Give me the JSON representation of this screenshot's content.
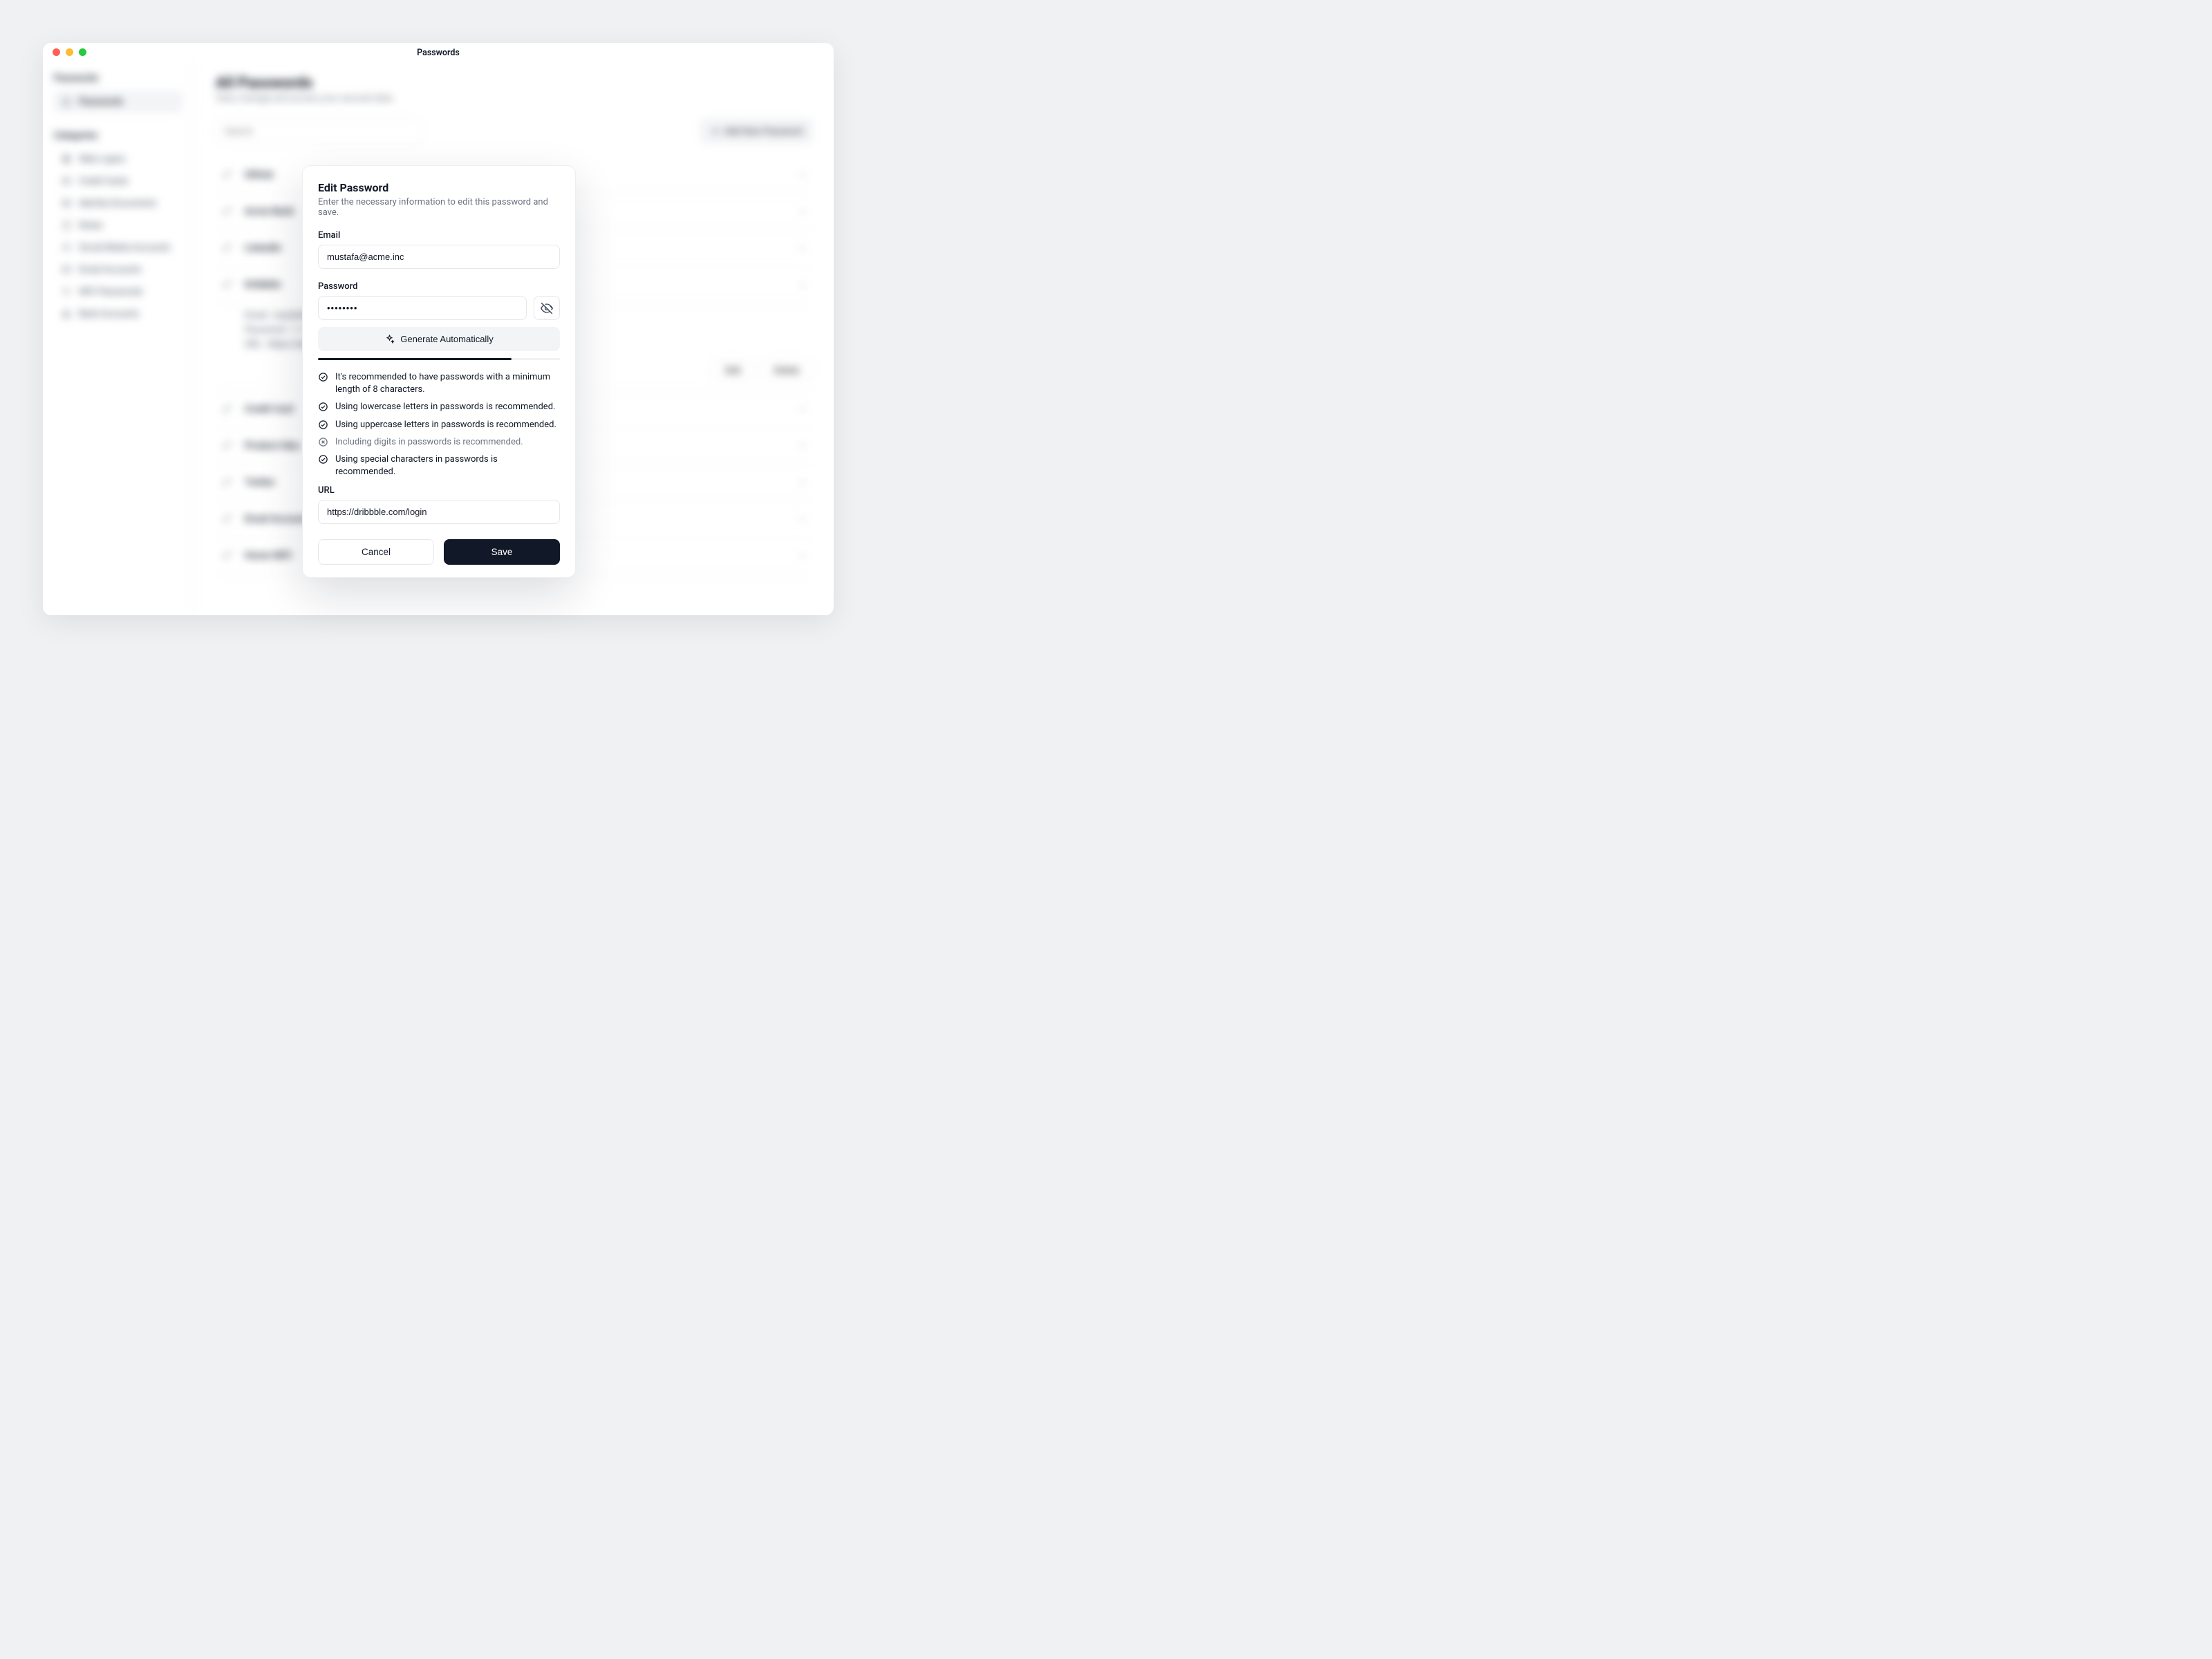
{
  "window": {
    "title": "Passwords"
  },
  "sidebar": {
    "sections": [
      {
        "title": "Passwords",
        "items": [
          {
            "icon": "lock",
            "label": "Passwords",
            "active": true
          }
        ]
      },
      {
        "title": "Categories",
        "items": [
          {
            "icon": "globe",
            "label": "Web Logins"
          },
          {
            "icon": "card",
            "label": "Credit Cards"
          },
          {
            "icon": "id",
            "label": "Identity Documents"
          },
          {
            "icon": "note",
            "label": "Notes"
          },
          {
            "icon": "people",
            "label": "Social Media Accounts"
          },
          {
            "icon": "mail",
            "label": "Email Accounts"
          },
          {
            "icon": "wifi",
            "label": "WiFi Passwords"
          },
          {
            "icon": "bank",
            "label": "Bank Accounts"
          }
        ]
      }
    ]
  },
  "main": {
    "title": "All Passwords",
    "subtitle": "View, manage and access your secured data.",
    "search_placeholder": "Search",
    "add_button_label": "Add New Password",
    "rows": [
      {
        "title": "Github"
      },
      {
        "title": "Acme Bank"
      },
      {
        "title": "LinkedIn"
      },
      {
        "title": "Dribbble",
        "expanded": true,
        "details": {
          "email_label": "Email:",
          "email": "mustafa@acme.inc",
          "password_label": "Password:",
          "password": "••••••••",
          "url_label": "URL:",
          "url": "https://dribbble.com/login"
        },
        "actions": {
          "edit": "Edit",
          "delete": "Delete"
        }
      },
      {
        "title": "Credit Card"
      },
      {
        "title": "Product Idea"
      },
      {
        "title": "Twitter"
      },
      {
        "title": "Email Account"
      },
      {
        "title": "Home WiFi"
      }
    ]
  },
  "modal": {
    "title": "Edit Password",
    "subtitle": "Enter the necessary information to edit this password and save.",
    "email_label": "Email",
    "email_value": "mustafa@acme.inc",
    "password_label": "Password",
    "password_value": "••••••••",
    "generate_label": "Generate Automatically",
    "strength_percent": 80,
    "checks": [
      {
        "pass": true,
        "text": "It's recommended to have passwords with a minimum length of 8 characters."
      },
      {
        "pass": true,
        "text": "Using lowercase letters in passwords is recommended."
      },
      {
        "pass": true,
        "text": "Using uppercase letters in passwords is recommended."
      },
      {
        "pass": false,
        "text": "Including digits in passwords is recommended."
      },
      {
        "pass": true,
        "text": "Using special characters in passwords is recommended."
      }
    ],
    "url_label": "URL",
    "url_value": "https://dribbble.com/login",
    "cancel_label": "Cancel",
    "save_label": "Save"
  }
}
